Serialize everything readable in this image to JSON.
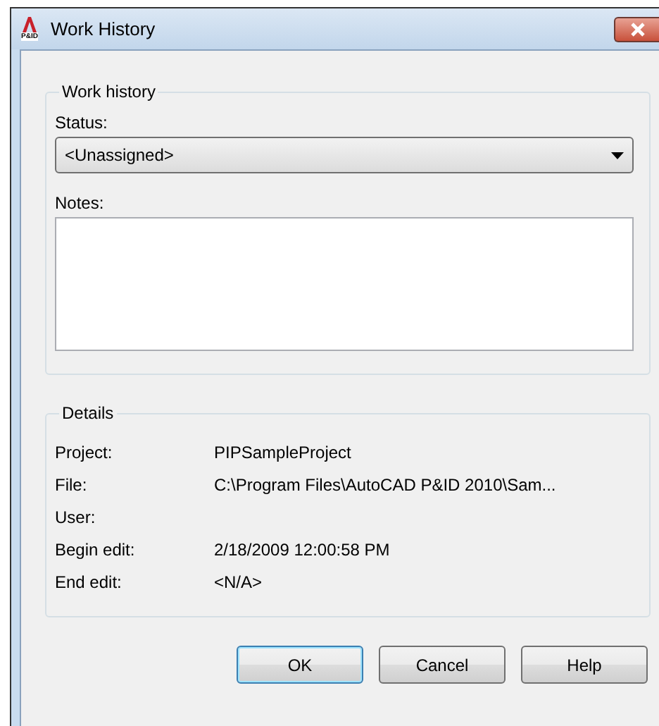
{
  "window": {
    "title": "Work History",
    "logo_text": "P&ID"
  },
  "work_history": {
    "legend": "Work history",
    "status_label": "Status:",
    "status_value": "<Unassigned>",
    "notes_label": "Notes:"
  },
  "details": {
    "legend": "Details",
    "rows": [
      {
        "label": "Project:",
        "value": "PIPSampleProject"
      },
      {
        "label": "File:",
        "value": "C:\\Program Files\\AutoCAD P&ID 2010\\Sam..."
      },
      {
        "label": "User:"
      },
      {
        "label": "Begin edit:",
        "value": "2/18/2009 12:00:58 PM"
      },
      {
        "label": "End edit:",
        "value": "<N/A>"
      }
    ]
  },
  "buttons": [
    {
      "label": "OK",
      "default": true
    },
    {
      "label": "Cancel",
      "default": false
    },
    {
      "label": "Help",
      "default": false
    }
  ]
}
